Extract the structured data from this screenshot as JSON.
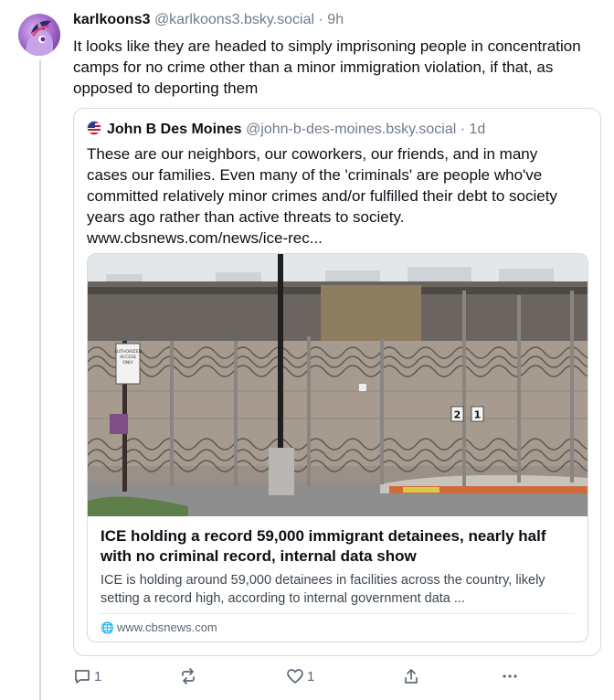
{
  "post": {
    "author": {
      "display_name": "karlkoons3",
      "handle": "@karlkoons3.bsky.social",
      "time": "9h",
      "avatar_icon": "pony-avatar-icon"
    },
    "separator": "·",
    "text": "It looks like they are headed to simply imprisoning people in concentration camps for no crime other than a minor immigration violation, if that, as opposed to deporting them",
    "quote": {
      "author": {
        "display_name": "John B Des Moines",
        "handle": "@john-b-des-moines.bsky.social",
        "time": "1d",
        "avatar_icon": "us-flag-avatar-icon"
      },
      "separator": "·",
      "text": "These are our neighbors, our coworkers, our friends, and in many cases our families. Even many of the 'criminals' are people who've committed relatively minor crimes and/or fulfilled their debt to society years ago rather than active threats to society. www.cbsnews.com/news/ice-rec...",
      "link_card": {
        "image_icon": "prison-fence-photo",
        "image_signs": {
          "sign_text": [
            "AUTHORIZED",
            "ACCESS",
            "ONLY"
          ],
          "numbers": [
            "2",
            "1"
          ]
        },
        "title": "ICE holding a record 59,000 immigrant detainees, nearly half with no criminal record, internal data show",
        "description": "ICE is holding around 59,000 detainees in facilities across the country, likely setting a record high, according to internal government data ...",
        "domain": "www.cbsnews.com",
        "domain_icon": "globe-icon"
      }
    },
    "actions": {
      "reply_count": "1",
      "repost_count": "",
      "like_count": "1"
    }
  },
  "colors": {
    "text_primary": "#0b0f14",
    "text_secondary": "#6f7c8c",
    "border": "#d4dbe2",
    "background": "#ffffff"
  }
}
